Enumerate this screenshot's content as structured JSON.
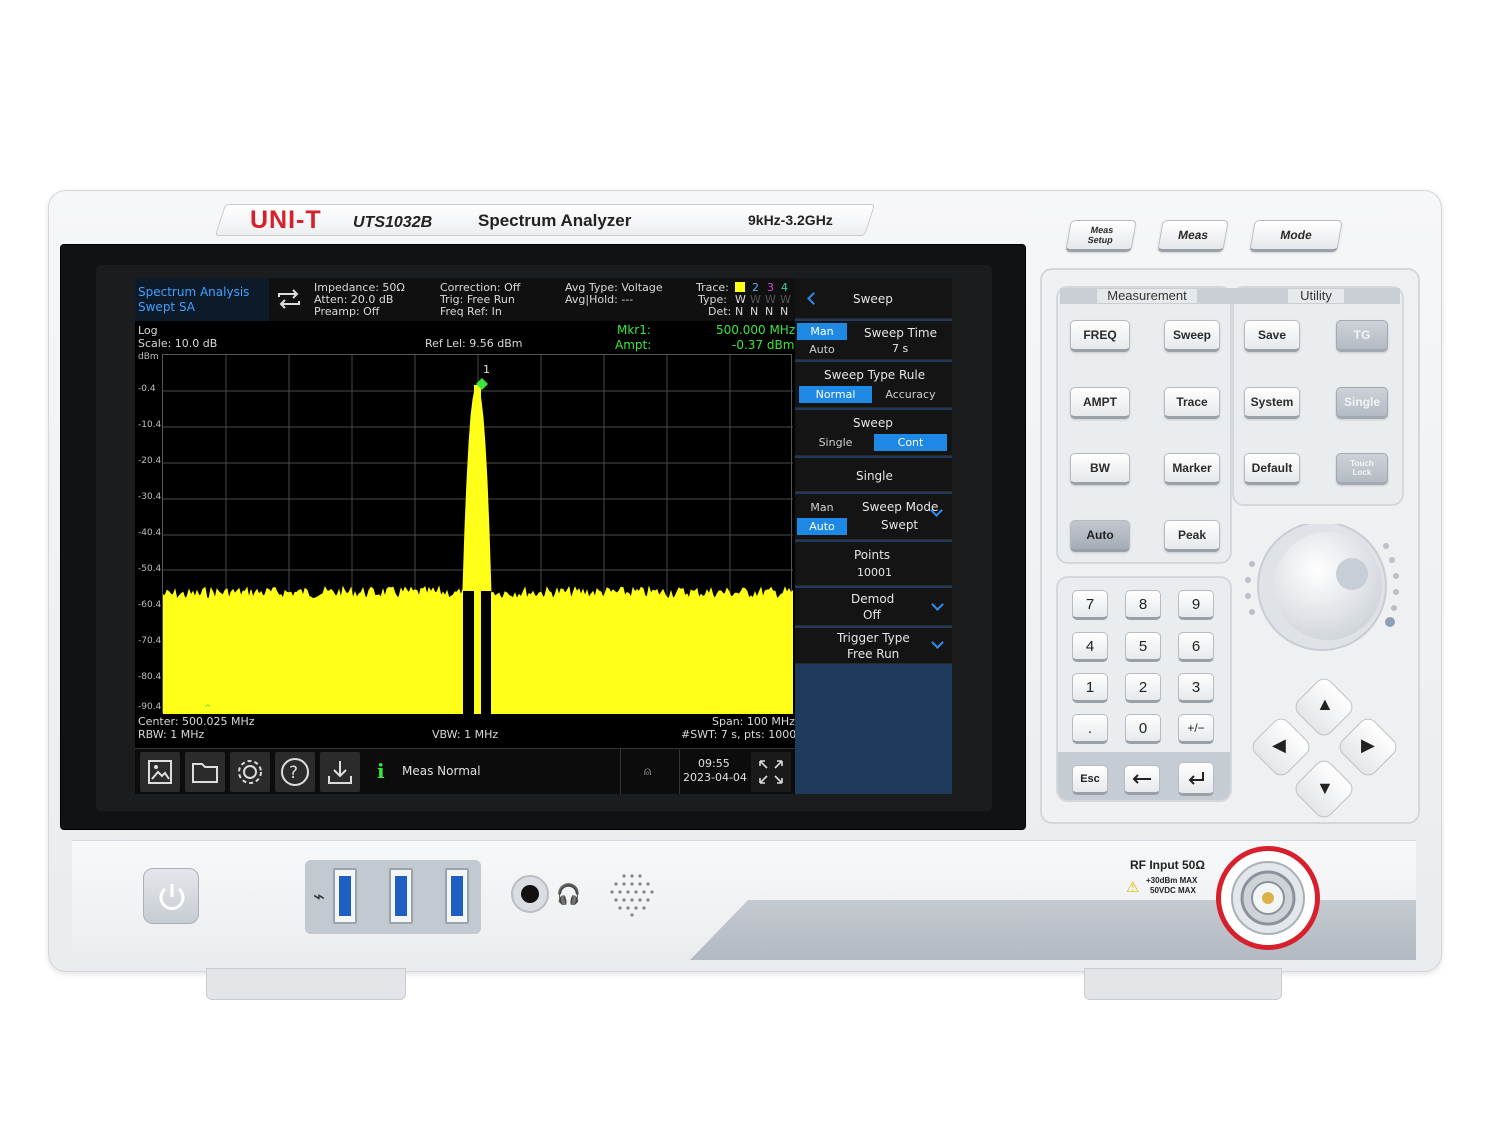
{
  "brand": {
    "logo": "UNI-T",
    "model": "UTS1032B",
    "device_type": "Spectrum Analyzer",
    "freq_range": "9kHz-3.2GHz"
  },
  "screen": {
    "mode_title": "Spectrum Analysis",
    "mode_sub": "Swept SA",
    "impedance": "Impedance: 50Ω",
    "atten": "Atten: 20.0 dB",
    "preamp": "Preamp: Off",
    "correction": "Correction: Off",
    "trig": "Trig: Free Run",
    "freq_ref": "Freq Ref: In",
    "avg_type": "Avg Type: Voltage",
    "avg_hold": "Avg|Hold: ---",
    "trace_label": "Trace:",
    "type_label": "Type:",
    "det_label": "Det:",
    "trace_nums": [
      "2",
      "3",
      "4"
    ],
    "type_vals": [
      "W",
      "W",
      "W",
      "W"
    ],
    "det_vals": [
      "N",
      "N",
      "N",
      "N"
    ],
    "scale_mode": "Log",
    "scale": "Scale: 10.0 dB",
    "ref_level": "Ref Lel: 9.56 dBm",
    "mkr_label": "Mkr1:",
    "mkr_freq": "500.000 MHz",
    "ampt_label": "Ampt:",
    "mkr_ampt": "-0.37 dBm",
    "y_unit": "dBm",
    "y_ticks": [
      "-0.4",
      "-10.4",
      "-20.4",
      "-30.4",
      "-40.4",
      "-50.4",
      "-60.4",
      "-70.4",
      "-80.4",
      "-90.4"
    ],
    "marker_num": "1",
    "center": "Center: 500.025 MHz",
    "rbw": "RBW: 1 MHz",
    "vbw": "VBW: 1 MHz",
    "span": "Span: 100 MHz",
    "swt": "#SWT: 7 s, pts: 10001",
    "status_msg": "Meas Normal",
    "time": "09:55",
    "date": "2023-04-04"
  },
  "menu": {
    "title": "Sweep",
    "man": "Man",
    "auto": "Auto",
    "sweep_time_label": "Sweep Time",
    "sweep_time_value": "7 s",
    "sweep_type_rule": "Sweep Type Rule",
    "normal": "Normal",
    "accuracy": "Accuracy",
    "sweep_label": "Sweep",
    "single_opt": "Single",
    "cont_opt": "Cont",
    "single_button": "Single",
    "sweep_mode_label": "Sweep Mode",
    "sweep_mode_value": "Swept",
    "points_label": "Points",
    "points_value": "10001",
    "demod_label": "Demod",
    "demod_value": "Off",
    "trigger_type_label": "Trigger Type",
    "trigger_type_value": "Free Run"
  },
  "keys": {
    "meas_setup_line1": "Meas",
    "meas_setup_line2": "Setup",
    "meas": "Meas",
    "mode": "Mode",
    "measurement_header": "Measurement",
    "utility_header": "Utility",
    "freq": "FREQ",
    "sweep": "Sweep",
    "save": "Save",
    "tg": "TG",
    "ampt": "AMPT",
    "trace": "Trace",
    "system": "System",
    "single": "Single",
    "bw": "BW",
    "marker": "Marker",
    "default": "Default",
    "touch": "Touch",
    "lock": "Lock",
    "auto": "Auto",
    "peak": "Peak",
    "num": [
      "7",
      "8",
      "9",
      "4",
      "5",
      "6",
      "1",
      "2",
      "3",
      ".",
      "0",
      "+/−"
    ],
    "esc": "Esc"
  },
  "front": {
    "rf_input": "RF Input  50Ω",
    "rf_warn1": "+30dBm MAX",
    "rf_warn2": "50VDC MAX"
  },
  "colors": {
    "trace": "#ffff1a",
    "accent": "#1e88e5",
    "marker": "#39e63a",
    "brand": "#d6202b"
  }
}
